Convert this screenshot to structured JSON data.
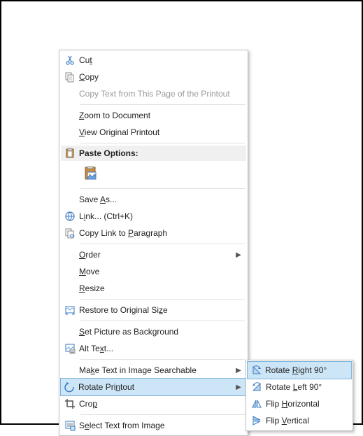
{
  "menu": {
    "cut": "Cut",
    "copy": "Copy",
    "copy_text": "Copy Text from This Page of the Printout",
    "zoom": "Zoom to Document",
    "view_orig": "View Original Printout",
    "paste_header": "Paste Options:",
    "save_as": "Save As...",
    "link": "Link...",
    "link_accel": "(Ctrl+K)",
    "copy_link_para": "Copy Link to Paragraph",
    "order": "Order",
    "move": "Move",
    "resize": "Resize",
    "restore": "Restore to Original Size",
    "set_bg": "Set Picture as Background",
    "alt_text": "Alt Text...",
    "make_search": "Make Text in Image Searchable",
    "rotate": "Rotate Printout",
    "crop": "Crop",
    "select_text": "Select Text from Image"
  },
  "submenu": {
    "rotate_right": "Rotate Right 90°",
    "rotate_left": "Rotate Left 90°",
    "flip_h": "Flip Horizontal",
    "flip_v": "Flip Vertical"
  }
}
